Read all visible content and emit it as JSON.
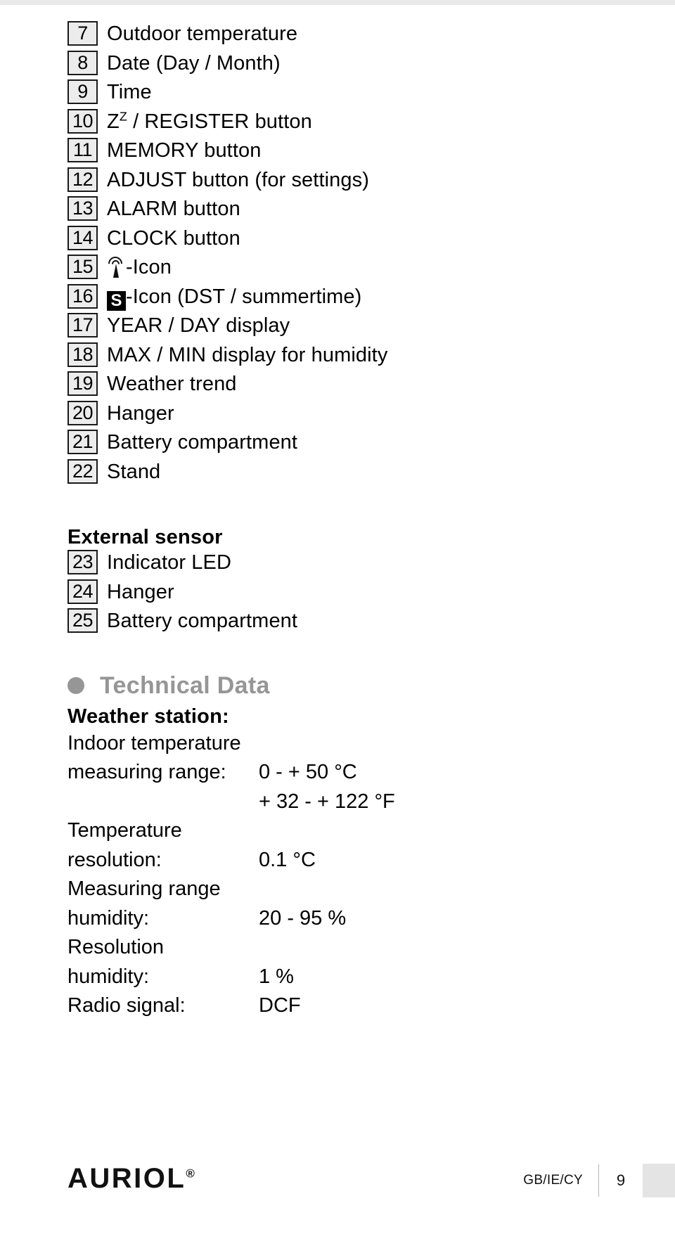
{
  "list_items": [
    {
      "num": "7",
      "label": "Outdoor temperature"
    },
    {
      "num": "8",
      "label": "Date (Day / Month)"
    },
    {
      "num": "9",
      "label": "Time"
    },
    {
      "num": "10",
      "label_pre": "Z",
      "label_sup": "Z",
      "label_post": " / REGISTER button"
    },
    {
      "num": "11",
      "label": "MEMORY button"
    },
    {
      "num": "12",
      "label": "ADJUST button (for settings)"
    },
    {
      "num": "13",
      "label": "ALARM button"
    },
    {
      "num": "14",
      "label": "CLOCK button"
    },
    {
      "num": "15",
      "icon": "radio-wave-icon",
      "label": "-Icon"
    },
    {
      "num": "16",
      "icon": "dst-s-icon",
      "icon_text": "S",
      "label": "-Icon (DST / summertime)"
    },
    {
      "num": "17",
      "label": "YEAR / DAY display"
    },
    {
      "num": "18",
      "label": "MAX / MIN display for humidity"
    },
    {
      "num": "19",
      "label": "Weather trend"
    },
    {
      "num": "20",
      "label": "Hanger"
    },
    {
      "num": "21",
      "label": "Battery compartment"
    },
    {
      "num": "22",
      "label": "Stand"
    }
  ],
  "external_sensor": {
    "heading": "External sensor",
    "items": [
      {
        "num": "23",
        "label": "Indicator LED"
      },
      {
        "num": "24",
        "label": "Hanger"
      },
      {
        "num": "25",
        "label": "Battery compartment"
      }
    ]
  },
  "technical_data": {
    "section_title": "Technical Data",
    "subheading": "Weather station:",
    "rows": [
      {
        "key": "Indoor temperature",
        "value": ""
      },
      {
        "key": "measuring range:",
        "value": "0 - + 50 °C"
      },
      {
        "key": "",
        "value": "+ 32 - + 122 °F"
      },
      {
        "key": "Temperature",
        "value": ""
      },
      {
        "key": "resolution:",
        "value": "0.1 °C"
      },
      {
        "key": "Measuring range",
        "value": ""
      },
      {
        "key": "humidity:",
        "value": "20 - 95 %"
      },
      {
        "key": "Resolution",
        "value": ""
      },
      {
        "key": "humidity:",
        "value": "1 %"
      },
      {
        "key": "Radio signal:",
        "value": "DCF"
      }
    ]
  },
  "footer": {
    "brand": "AURIOL",
    "brand_mark": "®",
    "locale": "GB/IE/CY",
    "page_number": "9"
  },
  "colors": {
    "num_box_fill": "#ececec",
    "section_title_gray": "#969696",
    "corner_box_gray": "#e4e4e4",
    "text_black": "#000000"
  }
}
